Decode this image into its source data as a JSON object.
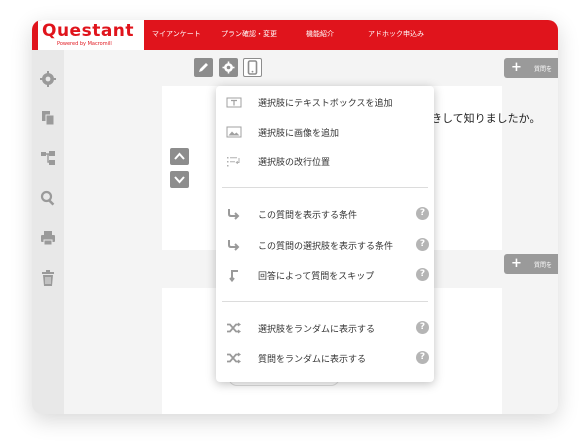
{
  "app": {
    "logo_text": "Questant",
    "logo_subtext": "Powered by Macromill"
  },
  "nav": {
    "items": [
      {
        "label": "マイアンケート"
      },
      {
        "label": "プラン確認・変更"
      },
      {
        "label": "機能紹介"
      },
      {
        "label": "アドホック申込み"
      }
    ]
  },
  "sidebar": {
    "icons": [
      "gear-icon",
      "copy-icon",
      "tree-icon",
      "search-icon",
      "print-icon",
      "trash-icon"
    ]
  },
  "question": {
    "text_fragment": "聞きして知りましたか。"
  },
  "toolbar": {
    "icons": [
      "pencil-icon",
      "gear-icon",
      "mobile-icon"
    ]
  },
  "add_question": {
    "plus": "+",
    "label": "質問を"
  },
  "menu": {
    "items": [
      {
        "label": "選択肢にテキストボックスを追加",
        "icon": "textbox-icon",
        "help": ""
      },
      {
        "label": "選択肢に画像を追加",
        "icon": "image-icon",
        "help": ""
      },
      {
        "label": "選択肢の改行位置",
        "icon": "linebreak-icon",
        "help": ""
      },
      {
        "label": "この質問を表示する条件",
        "icon": "branch-icon",
        "help": "?"
      },
      {
        "label": "この質問の選択肢を表示する条件",
        "icon": "branch-icon",
        "help": "?"
      },
      {
        "label": "回答によって質問をスキップ",
        "icon": "skip-icon",
        "help": "?"
      },
      {
        "label": "選択肢をランダムに表示する",
        "icon": "shuffle-icon",
        "help": "?"
      },
      {
        "label": "質問をランダムに表示する",
        "icon": "shuffle-icon",
        "help": "?"
      }
    ]
  },
  "colors": {
    "brand_red": "#e0141c",
    "toolbar_gray": "#8d8d8d",
    "icon_gray": "#9a9a9a"
  }
}
